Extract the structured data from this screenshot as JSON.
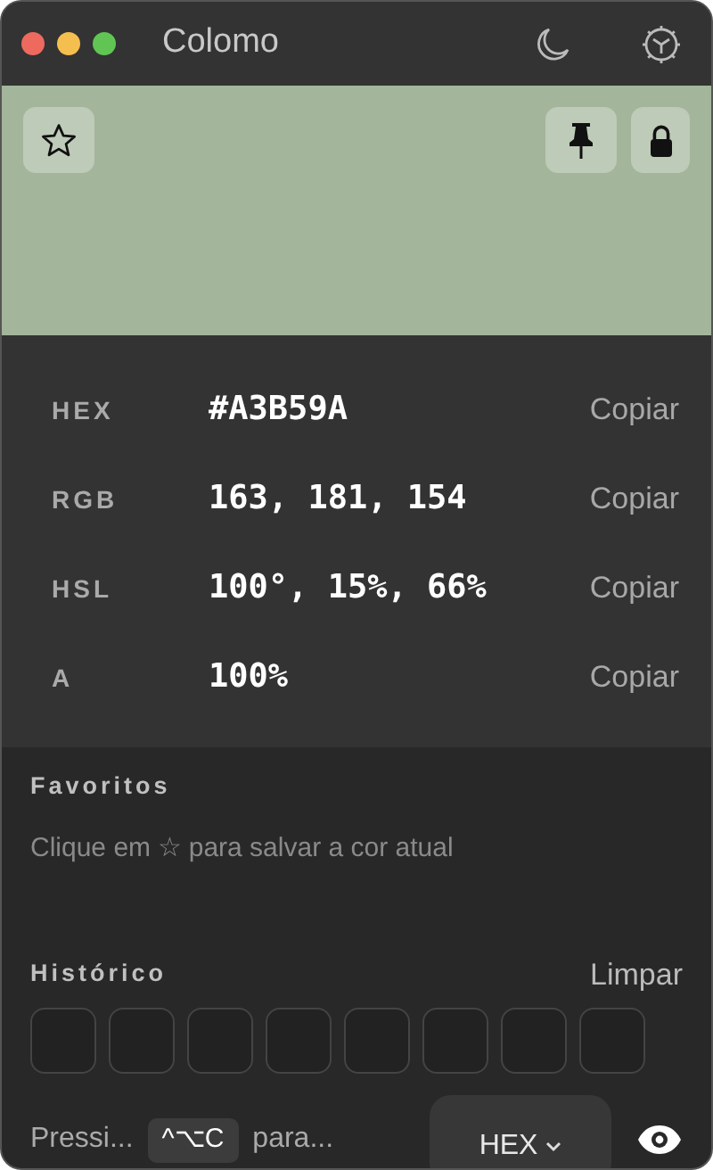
{
  "window": {
    "title": "Colomo"
  },
  "preview": {
    "color": "#a3b59a"
  },
  "values": [
    {
      "label": "HEX",
      "value": "#A3B59A",
      "action": "Copiar"
    },
    {
      "label": "RGB",
      "value": "163, 181, 154",
      "action": "Copiar"
    },
    {
      "label": "HSL",
      "value": "100°, 15%, 66%",
      "action": "Copiar"
    },
    {
      "label": "A",
      "value": "100%",
      "action": "Copiar"
    }
  ],
  "favorites": {
    "title": "Favoritos",
    "hint": "Clique em ☆ para salvar a cor atual"
  },
  "history": {
    "title": "Histórico",
    "clear": "Limpar",
    "slots": [
      {
        "kind": "empty"
      },
      {
        "kind": "empty"
      },
      {
        "kind": "empty"
      },
      {
        "kind": "empty"
      },
      {
        "kind": "empty"
      },
      {
        "kind": "empty"
      },
      {
        "kind": "empty"
      },
      {
        "kind": "empty"
      }
    ]
  },
  "footer": {
    "text_before": "Pressi...",
    "shortcut": "^⌥C",
    "text_after": "para...",
    "format": "HEX"
  }
}
